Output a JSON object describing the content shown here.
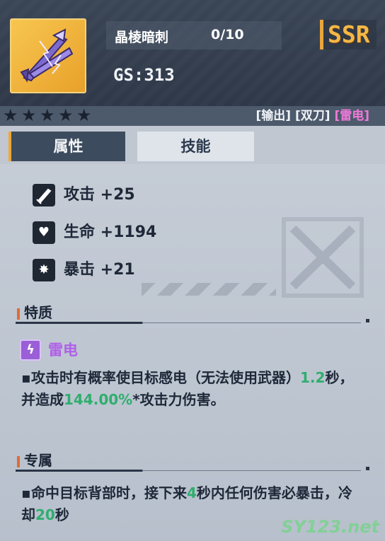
{
  "header": {
    "weapon_name": "晶棱暗刺",
    "level": "0/10",
    "gs": "GS:313",
    "rarity": "SSR"
  },
  "stars": {
    "count": 5
  },
  "tags": {
    "role": "[输出]",
    "weapon_type": "[双刀]",
    "element": "[雷电]"
  },
  "tabs": [
    {
      "label": "属性",
      "active": true
    },
    {
      "label": "技能",
      "active": false
    }
  ],
  "stats": [
    {
      "icon": "sword-icon",
      "text": "攻击 +25"
    },
    {
      "icon": "heart-icon",
      "text": "生命 +1194"
    },
    {
      "icon": "burst-icon",
      "text": "暴击 +21"
    }
  ],
  "trait": {
    "section_title": "特质",
    "element_name": "雷电",
    "desc_a": "攻击时有概率使目标感电（无法使用武器）",
    "duration": "1.2",
    "desc_b": "秒，并造成",
    "damage": "144.00%",
    "desc_c": "*攻击力伤害。"
  },
  "exclusive": {
    "section_title": "专属",
    "desc_a": "命中目标背部时，接下来",
    "seconds": "4",
    "desc_b": "秒内任何伤害必暴击，冷却",
    "cooldown": "20",
    "desc_c": "秒"
  },
  "watermark": "SY123.net",
  "colors": {
    "accent_orange": "#f0a832",
    "element_purple": "#b060e8",
    "highlight_green": "#2fae6e",
    "ssr_gold": "#f3b848"
  }
}
